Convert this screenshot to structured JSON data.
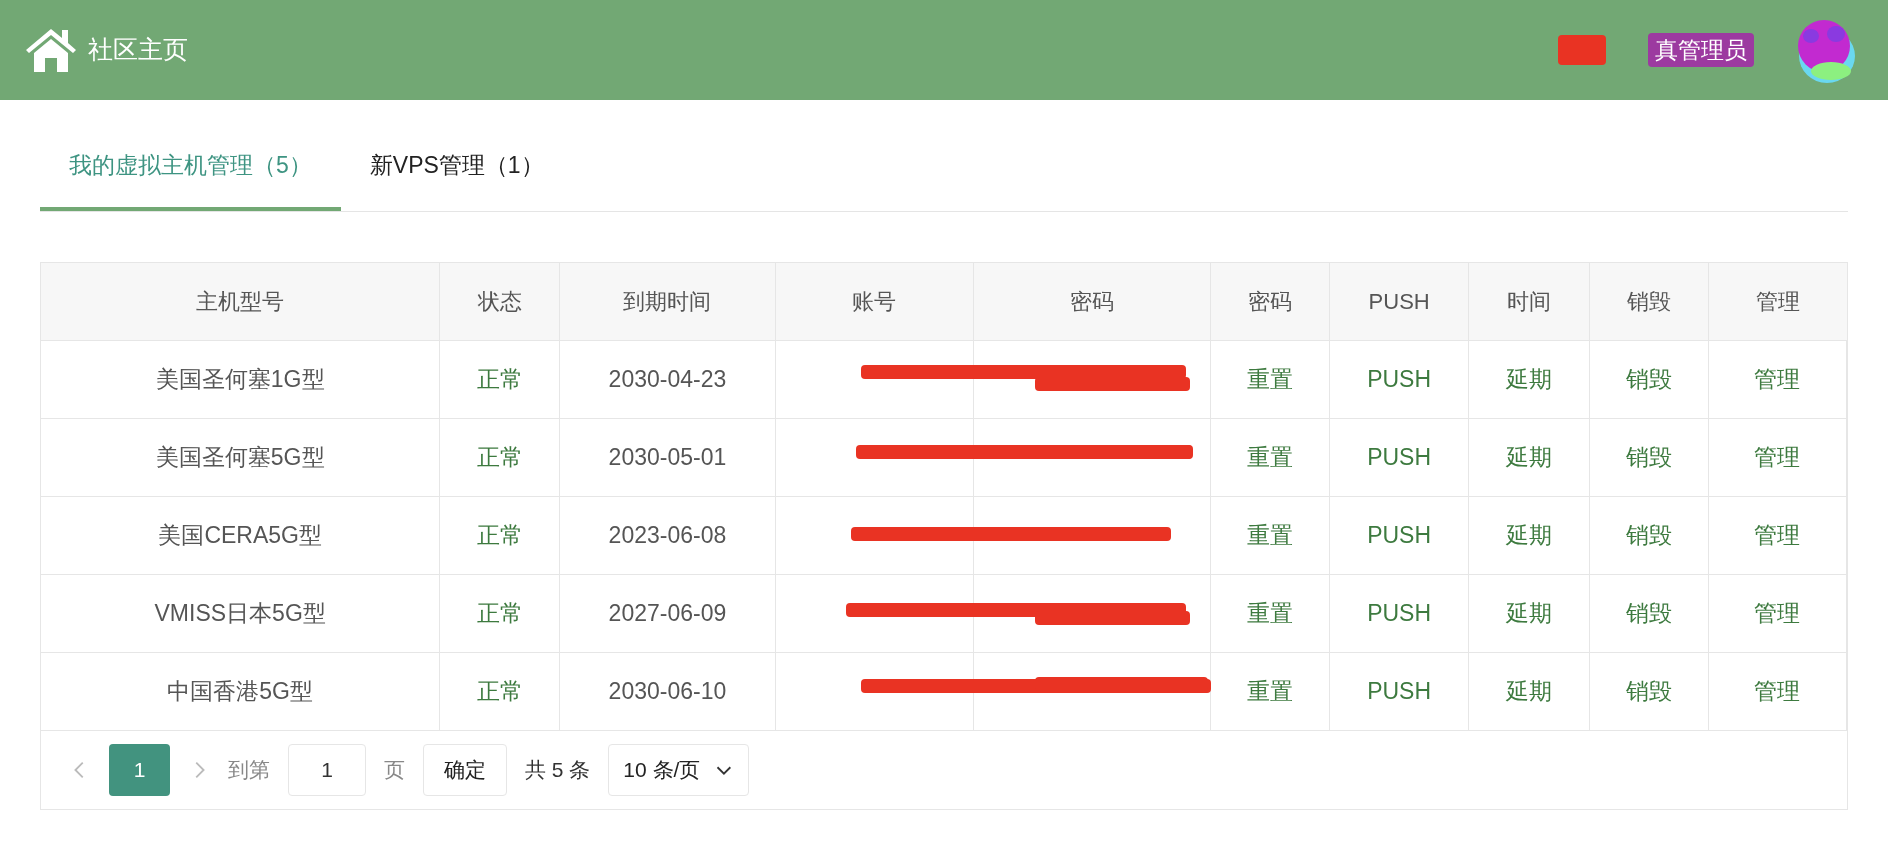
{
  "header": {
    "title": "社区主页",
    "role_badge": "真管理员"
  },
  "tabs": [
    {
      "label": "我的虚拟主机管理（5）",
      "selected": true
    },
    {
      "label": "新VPS管理（1）",
      "selected": false
    }
  ],
  "table": {
    "columns": [
      "主机型号",
      "状态",
      "到期时间",
      "账号",
      "密码",
      "密码",
      "PUSH",
      "时间",
      "销毁",
      "管理"
    ],
    "rows": [
      {
        "model": "美国圣何塞1G型",
        "status": "正常",
        "expiry": "2030-04-23",
        "actions": [
          "重置",
          "PUSH",
          "延期",
          "销毁",
          "管理"
        ]
      },
      {
        "model": "美国圣何塞5G型",
        "status": "正常",
        "expiry": "2030-05-01",
        "actions": [
          "重置",
          "PUSH",
          "延期",
          "销毁",
          "管理"
        ]
      },
      {
        "model": "美国CERA5G型",
        "status": "正常",
        "expiry": "2023-06-08",
        "actions": [
          "重置",
          "PUSH",
          "延期",
          "销毁",
          "管理"
        ]
      },
      {
        "model": "VMISS日本5G型",
        "status": "正常",
        "expiry": "2027-06-09",
        "actions": [
          "重置",
          "PUSH",
          "延期",
          "销毁",
          "管理"
        ]
      },
      {
        "model": "中国香港5G型",
        "status": "正常",
        "expiry": "2030-06-10",
        "actions": [
          "重置",
          "PUSH",
          "延期",
          "销毁",
          "管理"
        ]
      }
    ]
  },
  "pagination": {
    "pages": [
      {
        "label": "1",
        "selected": true
      }
    ],
    "goto_label": "到第",
    "page_input": "1",
    "page_unit": "页",
    "confirm": "确定",
    "total": "共 5 条",
    "page_size": "10 条/页"
  }
}
